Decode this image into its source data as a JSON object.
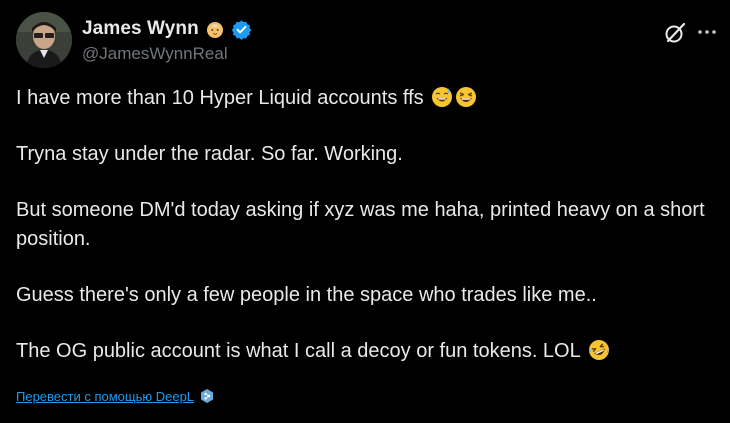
{
  "tweet": {
    "author": {
      "display_name": "James Wynn",
      "handle": "@JamesWynnReal",
      "avatar_icon": "profile-photo",
      "name_emoji": "baby-emoji",
      "verified_icon": "verified-badge-icon",
      "verified_color": "#1d9bf0"
    },
    "paragraphs": {
      "p1": "I have more than 10 Hyper Liquid accounts ffs",
      "p2": "Tryna stay under the radar. So far. Working.",
      "p3": "But someone DM'd today asking if xyz was me haha, printed heavy on a short position.",
      "p4": "Guess there's only a few people in the space who trades like me..",
      "p5": "The OG public account is what I call a decoy or fun tokens. LOL"
    },
    "emojis": {
      "p1": [
        "grinning-sweat-emoji",
        "squinting-grin-emoji"
      ],
      "p5": [
        "rolling-laughing-emoji"
      ]
    },
    "translate": {
      "label": "Перевести с помощью DeepL",
      "icon": "deepl-icon"
    }
  },
  "header_actions": {
    "grok_icon": "grok-icon",
    "more_icon": "more-icon"
  },
  "colors": {
    "background": "#000000",
    "text_primary": "#e7e9ea",
    "text_secondary": "#71767b",
    "link": "#1d9bf0"
  }
}
